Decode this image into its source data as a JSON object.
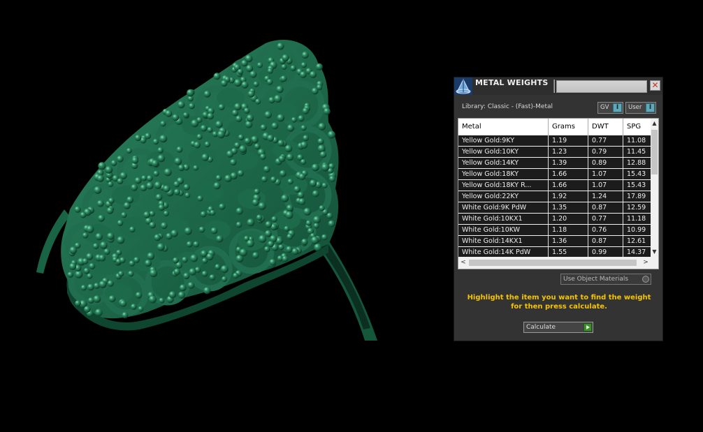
{
  "panel": {
    "title": "METAL WEIGHTS",
    "close_glyph": "✕",
    "library_label": "Library: Classic - (Fast)-Metal",
    "gv_label": "GV",
    "user_label": "User",
    "button_mark": "I",
    "use_object_materials_label": "Use Object Materials",
    "instructions_line1": "Highlight the item you want to find the weight",
    "instructions_line2": "for then press calculate.",
    "calculate_label": "Calculate"
  },
  "table": {
    "headers": {
      "metal": "Metal",
      "grams": "Grams",
      "dwt": "DWT",
      "spg": "SPG"
    },
    "rows": [
      {
        "metal": "Yellow Gold:9KY",
        "grams": "1.19",
        "dwt": "0.77",
        "spg": "11.08"
      },
      {
        "metal": "Yellow Gold:10KY",
        "grams": "1.23",
        "dwt": "0.79",
        "spg": "11.45"
      },
      {
        "metal": "Yellow Gold:14KY",
        "grams": "1.39",
        "dwt": "0.89",
        "spg": "12.88"
      },
      {
        "metal": "Yellow Gold:18KY",
        "grams": "1.66",
        "dwt": "1.07",
        "spg": "15.43"
      },
      {
        "metal": "Yellow Gold:18KY R...",
        "grams": "1.66",
        "dwt": "1.07",
        "spg": "15.43"
      },
      {
        "metal": "Yellow Gold:22KY",
        "grams": "1.92",
        "dwt": "1.24",
        "spg": "17.89"
      },
      {
        "metal": "White Gold:9K PdW",
        "grams": "1.35",
        "dwt": "0.87",
        "spg": "12.59"
      },
      {
        "metal": "White Gold:10KX1",
        "grams": "1.20",
        "dwt": "0.77",
        "spg": "11.18"
      },
      {
        "metal": "White Gold:10KW",
        "grams": "1.18",
        "dwt": "0.76",
        "spg": "10.99"
      },
      {
        "metal": "White Gold:14KX1",
        "grams": "1.36",
        "dwt": "0.87",
        "spg": "12.61"
      },
      {
        "metal": "White Gold:14K PdW",
        "grams": "1.55",
        "dwt": "0.99",
        "spg": "14.37"
      }
    ]
  },
  "scroll": {
    "up": "▲",
    "down": "▼",
    "left": "<",
    "right": ">"
  },
  "colors": {
    "ring_green": "#1f6b4c",
    "ring_highlight": "#2f8a65",
    "accent_yellow": "#f5c400",
    "button_teal": "#5fa7b9"
  }
}
